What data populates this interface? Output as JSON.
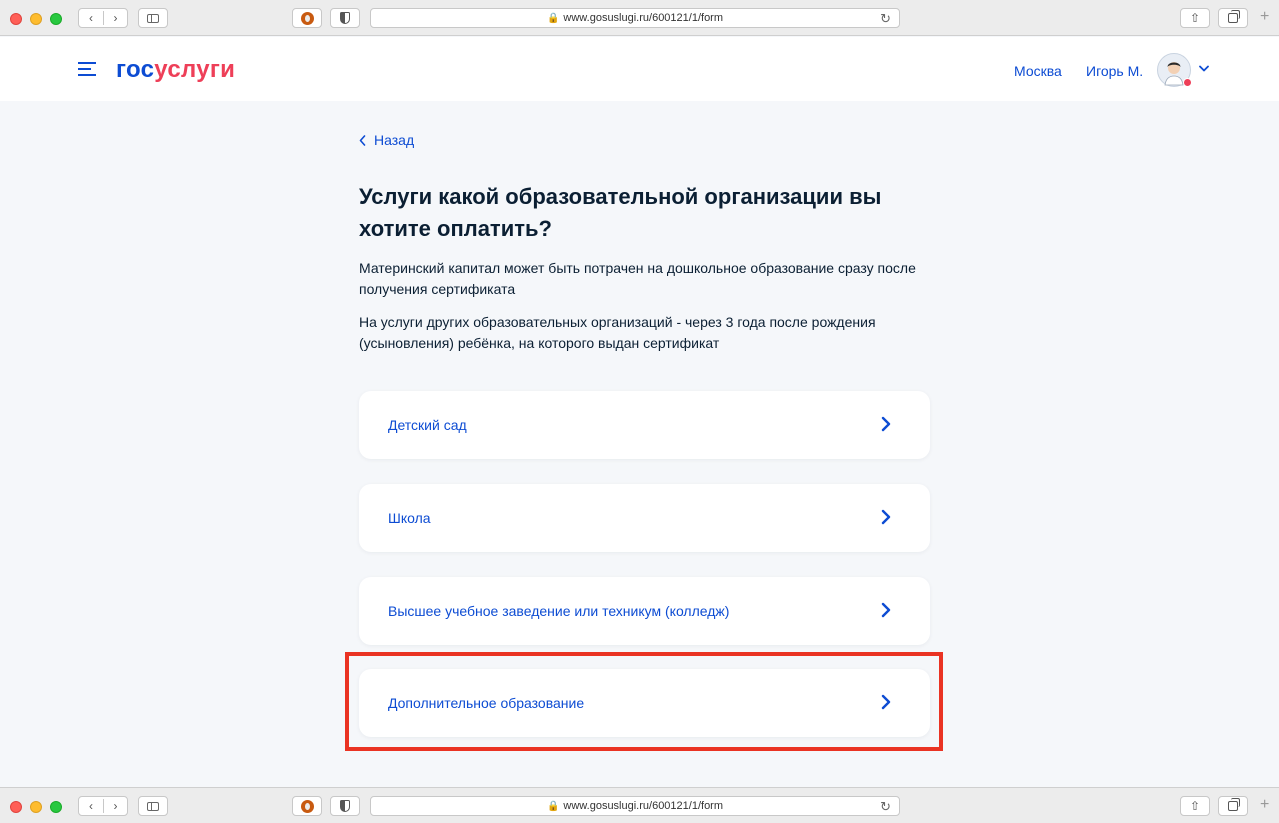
{
  "browser": {
    "url": "www.gosuslugi.ru/600121/1/form",
    "lock_glyph": "🔒",
    "back_glyph": "‹",
    "forward_glyph": "›",
    "reload_glyph": "↻",
    "share_glyph": "⇧",
    "plus_glyph": "+"
  },
  "header": {
    "logo_part1": "гос",
    "logo_part2": "услуги",
    "city": "Москва",
    "user_name": "Игорь М."
  },
  "main": {
    "back_label": "Назад",
    "title": "Услуги какой образовательной организации вы хотите оплатить?",
    "description_1": "Материнский капитал может быть потрачен на дошкольное образование сразу после получения сертификата",
    "description_2": "На услуги других образовательных организаций - через 3 года после рождения (усыновления) ребёнка, на которого выдан сертификат",
    "options": [
      {
        "label": "Детский сад"
      },
      {
        "label": "Школа"
      },
      {
        "label": "Высшее учебное заведение или техникум (колледж)"
      },
      {
        "label": "Дополнительное образование"
      }
    ]
  },
  "colors": {
    "brand_blue": "#0d4cd3",
    "brand_red": "#ee3f58",
    "highlight_red": "#ea3323",
    "page_bg": "#f5f7fa"
  },
  "icons": {
    "menu": "hamburger-menu-icon",
    "option_arrow": "chevron-right-icon",
    "back": "chevron-left-icon",
    "avatar_dropdown": "chevron-down-icon"
  }
}
